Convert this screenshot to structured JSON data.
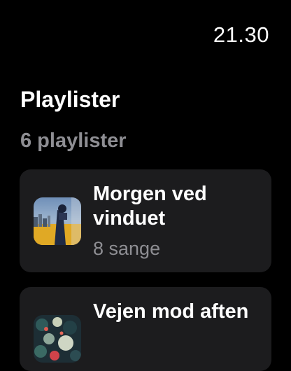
{
  "status": {
    "time": "21.30"
  },
  "header": {
    "title": "Playlister"
  },
  "section": {
    "count_label": "6 playlister"
  },
  "playlists": [
    {
      "title": "Morgen ved vinduet",
      "subtitle": "8 sange",
      "artwork": "city-window-photo"
    },
    {
      "title": "Vejen mod aften",
      "artwork": "abstract-floral-photo"
    }
  ],
  "colors": {
    "background": "#000000",
    "card": "#1c1c1e",
    "secondary_text": "#8e8e93",
    "primary_text": "#ffffff"
  }
}
